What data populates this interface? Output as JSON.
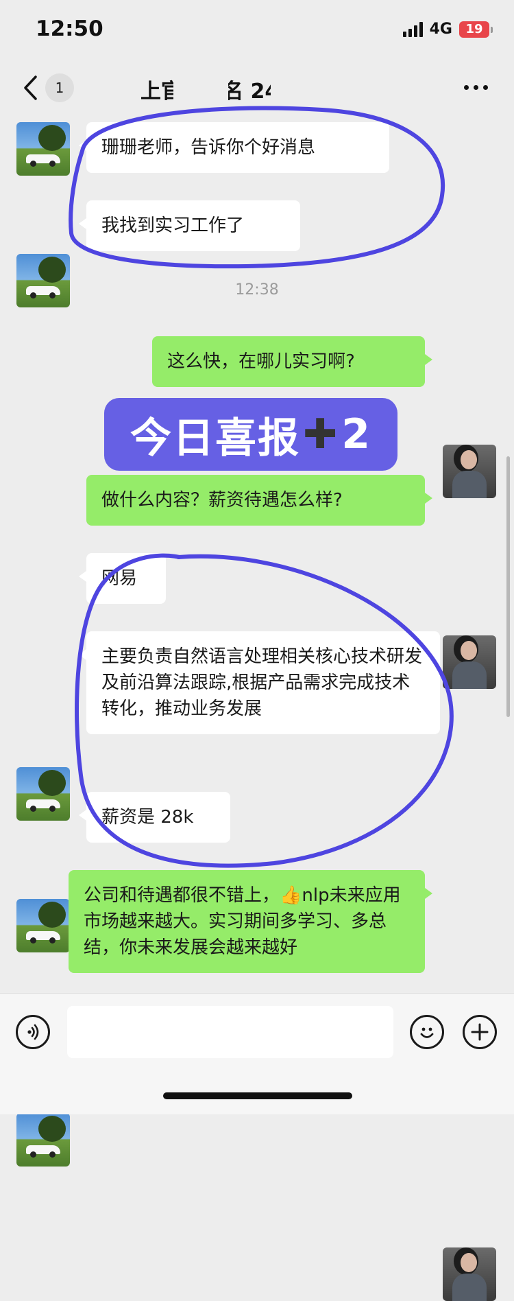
{
  "status_bar": {
    "time": "12:50",
    "network": "4G",
    "battery": "19"
  },
  "nav": {
    "unread_count": "1",
    "title": "上官号报名 24"
  },
  "messages": [
    {
      "side": "left",
      "avatar": "car-photo-avatar",
      "text": "珊珊老师，告诉你个好消息"
    },
    {
      "side": "left",
      "avatar": "car-photo-avatar",
      "text": "我找到实习工作了"
    },
    {
      "side": "right",
      "avatar": "woman-photo-avatar",
      "text": "这么快，在哪儿实习啊?"
    },
    {
      "side": "right",
      "avatar": "woman-photo-avatar",
      "text": "做什么内容？薪资待遇怎么样?"
    },
    {
      "side": "left",
      "avatar": "car-photo-avatar",
      "text": "网易"
    },
    {
      "side": "left",
      "avatar": "car-photo-avatar",
      "text": "主要负责自然语言处理相关核心技术研发及前沿算法跟踪,根据产品需求完成技术转化，推动业务发展"
    },
    {
      "side": "left",
      "avatar": "car-photo-avatar",
      "text": "薪资是 28k"
    },
    {
      "side": "right",
      "avatar": "woman-photo-avatar",
      "text": "公司和待遇都很不错上，👍nlp未来应用市场越来越大。实习期间多学习、多总结，你未来发展会越来越好"
    }
  ],
  "timestamp": "12:38",
  "banner": {
    "main": "今日喜报",
    "plus": "➕",
    "count": "2"
  },
  "input": {
    "value": "",
    "placeholder": ""
  },
  "colors": {
    "background": "#ededed",
    "incoming_bubble": "#ffffff",
    "outgoing_bubble": "#95ec69",
    "banner": "#6660e4",
    "annotation": "#4e45e0"
  },
  "icons": [
    "back-chevron-icon",
    "more-dots-icon",
    "voice-icon",
    "emoji-icon",
    "plus-icon"
  ]
}
